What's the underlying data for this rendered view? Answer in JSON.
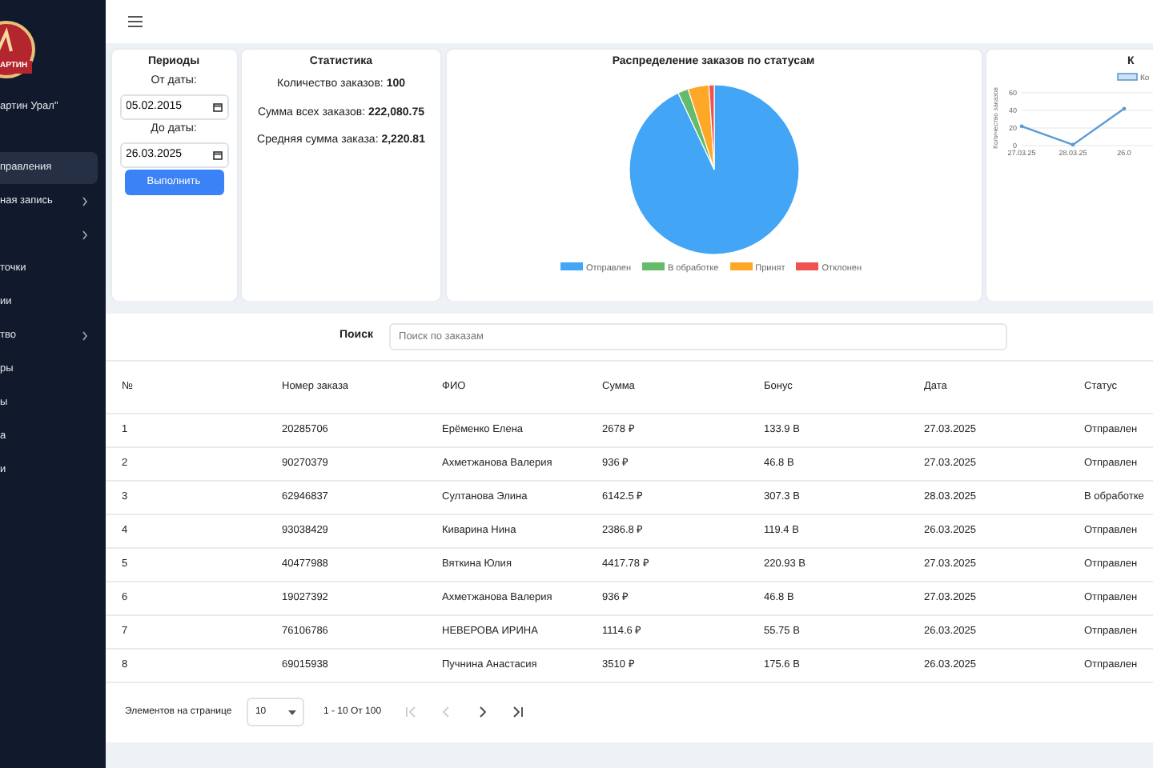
{
  "sidebar": {
    "logo_text": "АРТИН",
    "company": "артин Урал\"",
    "items": [
      {
        "label": "правления",
        "selected": true,
        "has_children": false
      },
      {
        "label": "ная запись",
        "selected": false,
        "has_children": true
      },
      {
        "selected": false,
        "has_children": true
      },
      {
        "label": "точки",
        "selected": false,
        "has_children": false
      },
      {
        "label": "ии",
        "selected": false,
        "has_children": false
      },
      {
        "label": "тво",
        "selected": false,
        "has_children": true
      },
      {
        "label": "ры",
        "selected": false,
        "has_children": false
      },
      {
        "label": "ы",
        "selected": false,
        "has_children": false
      },
      {
        "label": "а",
        "selected": false,
        "has_children": false
      },
      {
        "label": "и",
        "selected": false,
        "has_children": false
      }
    ]
  },
  "periods": {
    "title": "Периоды",
    "from_label": "От даты:",
    "from_value": "05.02.2015",
    "to_label": "До даты:",
    "to_value": "26.03.2025",
    "button": "Выполнить"
  },
  "statistics": {
    "title": "Статистика",
    "lines": [
      "Количество заказов: **100**",
      "Сумма всех заказов: **222,080.75**",
      "Средняя сумма заказа: **2,220.81**"
    ]
  },
  "pie": {
    "chart_data": {
      "type": "pie",
      "title": "Распределение заказов по статусам",
      "categories": [
        "Отправлен",
        "В обработке",
        "Принят",
        "Отклонен"
      ],
      "values": [
        93,
        2,
        4,
        1
      ],
      "colors": [
        "#42a5f5",
        "#66bb6a",
        "#ffa726",
        "#ef5350"
      ]
    }
  },
  "line": {
    "chart_data": {
      "type": "line",
      "title": "К",
      "ylabel": "Количество заказов",
      "categories": [
        "27.03.25",
        "28.03.25",
        "26.0"
      ],
      "series": [
        {
          "name": "Ко",
          "color": "#5b9bd5",
          "values": [
            22,
            1,
            42
          ]
        }
      ],
      "ylim": [
        0,
        60
      ],
      "yticks": [
        0,
        20,
        40,
        60
      ]
    }
  },
  "search": {
    "label": "Поиск",
    "placeholder": "Поиск по заказам"
  },
  "table": {
    "columns": [
      "№",
      "Номер заказа",
      "ФИО",
      "Сумма",
      "Бонус",
      "Дата",
      "Статус"
    ],
    "rows": [
      [
        "1",
        "20285706",
        "Ерёменко Елена",
        "2678 ₽",
        "133.9 B",
        "27.03.2025",
        "Отправлен"
      ],
      [
        "2",
        "90270379",
        "Ахметжанова Валерия",
        "936 ₽",
        "46.8 B",
        "27.03.2025",
        "Отправлен"
      ],
      [
        "3",
        "62946837",
        "Султанова Элина",
        "6142.5 ₽",
        "307.3 B",
        "28.03.2025",
        "В обработке"
      ],
      [
        "4",
        "93038429",
        "Киварина Нина",
        "2386.8 ₽",
        "119.4 B",
        "26.03.2025",
        "Отправлен"
      ],
      [
        "5",
        "40477988",
        "Вяткина Юлия",
        "4417.78 ₽",
        "220.93 B",
        "27.03.2025",
        "Отправлен"
      ],
      [
        "6",
        "19027392",
        "Ахметжанова Валерия",
        "936 ₽",
        "46.8 B",
        "27.03.2025",
        "Отправлен"
      ],
      [
        "7",
        "76106786",
        "НЕВЕРОВА ИРИНА",
        "1114.6 ₽",
        "55.75 B",
        "26.03.2025",
        "Отправлен"
      ],
      [
        "8",
        "69015938",
        "Пучнина Анастасия",
        "3510 ₽",
        "175.6 B",
        "26.03.2025",
        "Отправлен"
      ]
    ]
  },
  "pagination": {
    "label": "Элементов на странице",
    "page_size": "10",
    "range": "1 - 10 От 100",
    "buttons": [
      {
        "kind": "first",
        "disabled": true
      },
      {
        "kind": "prev",
        "disabled": true
      },
      {
        "kind": "next",
        "disabled": false
      },
      {
        "kind": "last",
        "disabled": false
      }
    ]
  }
}
